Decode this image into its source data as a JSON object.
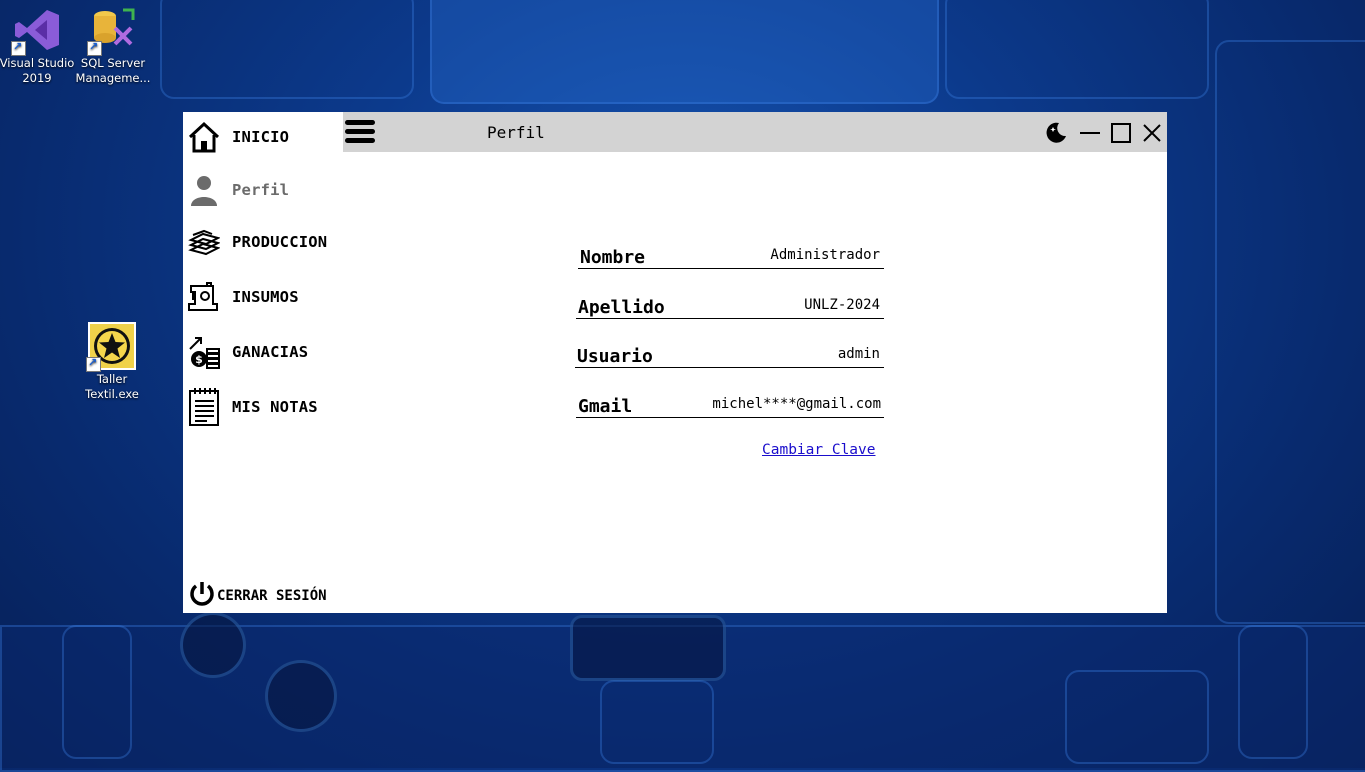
{
  "desktop": {
    "icons": [
      {
        "name": "Visual Studio 2019",
        "line1": "Visual Studio",
        "line2": "2019"
      },
      {
        "name": "SQL Server Management",
        "line1": "SQL Server",
        "line2": "Manageme..."
      },
      {
        "name": "Taller Textil.exe",
        "line1": "Taller",
        "line2": "Textil.exe"
      }
    ]
  },
  "app": {
    "page_title": "Perfil",
    "nav": [
      {
        "label": "INICIO",
        "icon": "home-icon"
      },
      {
        "label": "Perfil",
        "icon": "user-icon"
      },
      {
        "label": "PRODUCCION",
        "icon": "fabric-stack-icon"
      },
      {
        "label": "INSUMOS",
        "icon": "sewing-machine-icon"
      },
      {
        "label": "GANACIAS",
        "icon": "money-growth-icon"
      },
      {
        "label": "MIS NOTAS",
        "icon": "notepad-icon"
      }
    ],
    "logout_label": "CERRAR SESIÓN",
    "profile": {
      "nombre_label": "Nombre",
      "nombre_value": "Administrador",
      "apellido_label": "Apellido",
      "apellido_value": "UNLZ-2024",
      "usuario_label": "Usuario",
      "usuario_value": "admin",
      "gmail_label": "Gmail",
      "gmail_value": "michel****@gmail.com",
      "change_password": "Cambiar Clave"
    },
    "colors": {
      "topbar": "#d3d3d3",
      "link": "#1a0dcc",
      "desktop": "#0c3a8c"
    }
  }
}
